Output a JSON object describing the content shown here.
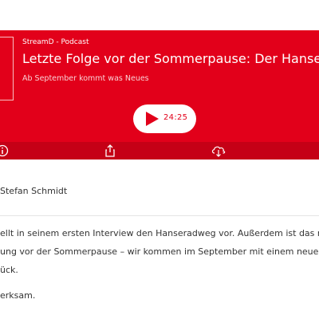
{
  "player": {
    "podcast_label": "StreamD - Podcast",
    "episode_title": "Letzte Folge vor der Sommerpause: Der Hanserad",
    "episode_subtitle": "Ab September kommt was Neues",
    "duration": "24:25",
    "colors": {
      "accent": "#e2001a",
      "toolbar": "#c50016"
    },
    "toolbar_icons": [
      "info-icon",
      "share-icon",
      "download-cloud-icon"
    ]
  },
  "article": {
    "author": "Stefan Schmidt",
    "lines": [
      "ellt in seinem ersten Interview den Hanseradweg vor. Außerdem ist das nic",
      "ung vor der Sommerpause – wir kommen im September mit einem neuen",
      "ück.",
      "erksam."
    ]
  }
}
